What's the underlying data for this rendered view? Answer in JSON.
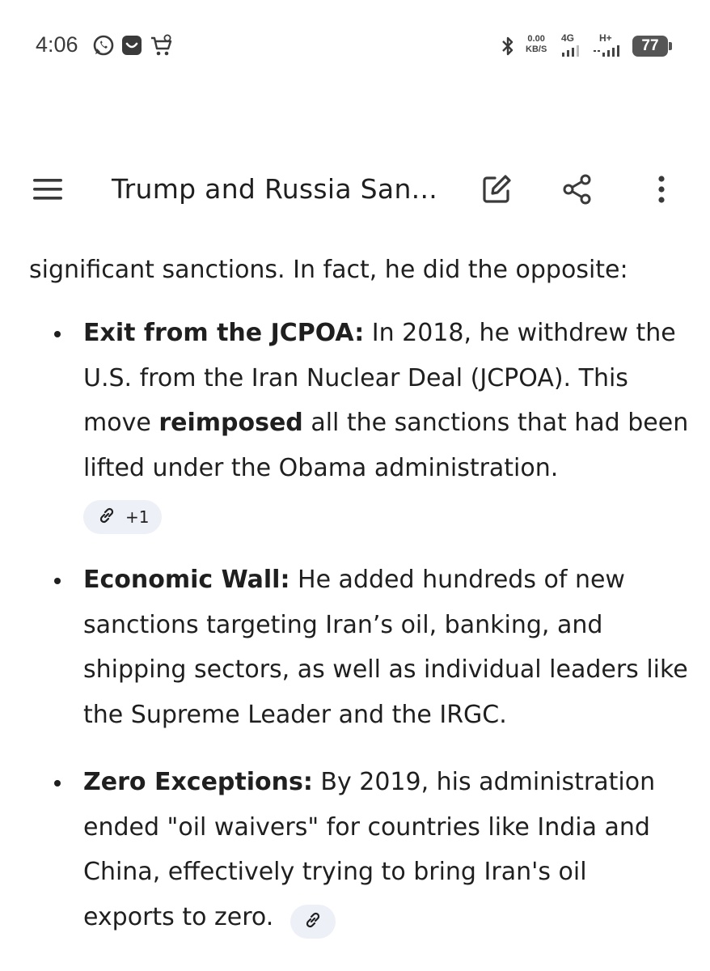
{
  "status_bar": {
    "time": "4:06",
    "speed_value": "0.00",
    "speed_unit": "KB/S",
    "network_1": "4G",
    "network_2": "H+",
    "battery": "77"
  },
  "app_bar": {
    "title": "Trump and Russia San...",
    "icons": [
      "menu-icon",
      "edit-icon",
      "share-icon",
      "more-vert-icon"
    ]
  },
  "content": {
    "lead": "significant sanctions. In fact, he did the opposite:",
    "bullets": [
      {
        "term": "Exit from the JCPOA:",
        "text_a": " In 2018, he withdrew the U.S. from the Iran Nuclear Deal (JCPOA). This move ",
        "emph": "reimposed",
        "text_b": " all the sanctions that had been lifted under the Obama administration.",
        "source_count": "+1"
      },
      {
        "term": "Economic Wall:",
        "text": " He added hundreds of new sanctions targeting Iran’s oil, banking, and shipping sectors, as well as individual leaders like the Supreme Leader and the IRGC."
      },
      {
        "term": "Zero Exceptions:",
        "text": " By 2019, his administration ended \"oil waivers\" for countries like India and China, effectively trying to bring Iran's oil exports to zero."
      }
    ]
  },
  "colors": {
    "text": "#1f1f1f",
    "chip_bg": "#edf0f7",
    "status_text": "#3a3a3a"
  }
}
